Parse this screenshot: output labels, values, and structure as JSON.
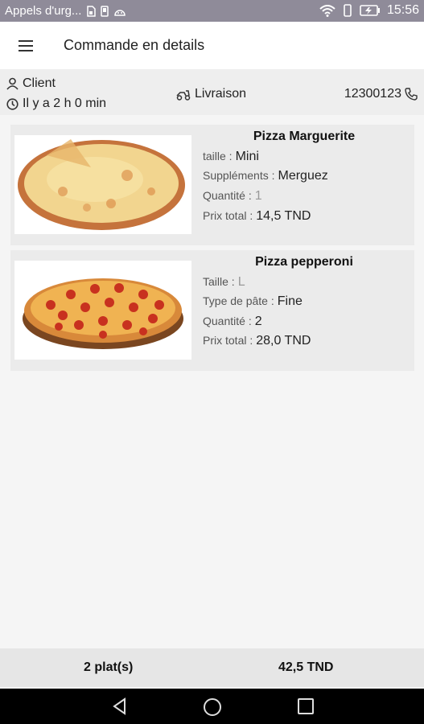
{
  "status_bar": {
    "carrier": "Appels d'urg...",
    "time": "15:56",
    "icons": [
      "sim-icon",
      "sd-card-icon",
      "android-icon",
      "wifi-icon",
      "vibrate-icon",
      "battery-icon"
    ]
  },
  "header": {
    "title": "Commande en details",
    "menu_icon": "hamburger-icon"
  },
  "order_info": {
    "client_label": "Client",
    "time_ago": "Il y a 2 h 0 min",
    "delivery_label": "Livraison",
    "phone": "12300123"
  },
  "items": [
    {
      "name": "Pizza Marguerite",
      "fields": [
        {
          "label": "taille :",
          "value": "Mini"
        },
        {
          "label": "Suppléments :",
          "value": "Merguez"
        },
        {
          "label": "Quantité :",
          "value": "1"
        },
        {
          "label": "Prix total :",
          "value": "14,5 TND"
        }
      ]
    },
    {
      "name": "Pizza pepperoni",
      "fields": [
        {
          "label": "Taille :",
          "value": "L"
        },
        {
          "label": "Type de pâte  :",
          "value": "Fine"
        },
        {
          "label": "Quantité :",
          "value": "2"
        },
        {
          "label": "Prix total :",
          "value": "28,0 TND"
        }
      ]
    }
  ],
  "footer": {
    "plates": "2 plat(s)",
    "total": "42,5 TND"
  },
  "colors": {
    "status_bar": "#8f8b99",
    "card_bg": "#ebebeb",
    "info_bg": "#eeeeee"
  }
}
